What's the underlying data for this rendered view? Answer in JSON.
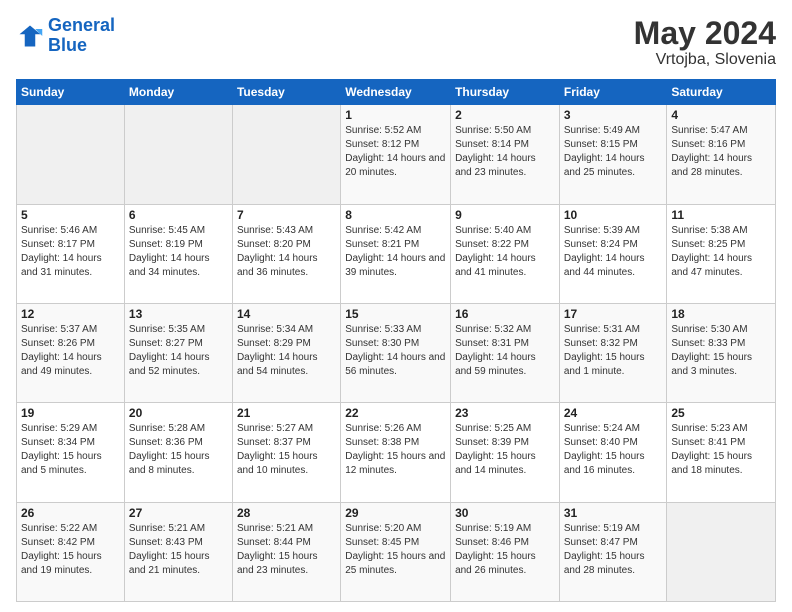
{
  "header": {
    "logo_line1": "General",
    "logo_line2": "Blue",
    "title": "May 2024",
    "subtitle": "Vrtojba, Slovenia"
  },
  "days_of_week": [
    "Sunday",
    "Monday",
    "Tuesday",
    "Wednesday",
    "Thursday",
    "Friday",
    "Saturday"
  ],
  "weeks": [
    [
      {
        "day": "",
        "sunrise": "",
        "sunset": "",
        "daylight": ""
      },
      {
        "day": "",
        "sunrise": "",
        "sunset": "",
        "daylight": ""
      },
      {
        "day": "",
        "sunrise": "",
        "sunset": "",
        "daylight": ""
      },
      {
        "day": "1",
        "sunrise": "Sunrise: 5:52 AM",
        "sunset": "Sunset: 8:12 PM",
        "daylight": "Daylight: 14 hours and 20 minutes."
      },
      {
        "day": "2",
        "sunrise": "Sunrise: 5:50 AM",
        "sunset": "Sunset: 8:14 PM",
        "daylight": "Daylight: 14 hours and 23 minutes."
      },
      {
        "day": "3",
        "sunrise": "Sunrise: 5:49 AM",
        "sunset": "Sunset: 8:15 PM",
        "daylight": "Daylight: 14 hours and 25 minutes."
      },
      {
        "day": "4",
        "sunrise": "Sunrise: 5:47 AM",
        "sunset": "Sunset: 8:16 PM",
        "daylight": "Daylight: 14 hours and 28 minutes."
      }
    ],
    [
      {
        "day": "5",
        "sunrise": "Sunrise: 5:46 AM",
        "sunset": "Sunset: 8:17 PM",
        "daylight": "Daylight: 14 hours and 31 minutes."
      },
      {
        "day": "6",
        "sunrise": "Sunrise: 5:45 AM",
        "sunset": "Sunset: 8:19 PM",
        "daylight": "Daylight: 14 hours and 34 minutes."
      },
      {
        "day": "7",
        "sunrise": "Sunrise: 5:43 AM",
        "sunset": "Sunset: 8:20 PM",
        "daylight": "Daylight: 14 hours and 36 minutes."
      },
      {
        "day": "8",
        "sunrise": "Sunrise: 5:42 AM",
        "sunset": "Sunset: 8:21 PM",
        "daylight": "Daylight: 14 hours and 39 minutes."
      },
      {
        "day": "9",
        "sunrise": "Sunrise: 5:40 AM",
        "sunset": "Sunset: 8:22 PM",
        "daylight": "Daylight: 14 hours and 41 minutes."
      },
      {
        "day": "10",
        "sunrise": "Sunrise: 5:39 AM",
        "sunset": "Sunset: 8:24 PM",
        "daylight": "Daylight: 14 hours and 44 minutes."
      },
      {
        "day": "11",
        "sunrise": "Sunrise: 5:38 AM",
        "sunset": "Sunset: 8:25 PM",
        "daylight": "Daylight: 14 hours and 47 minutes."
      }
    ],
    [
      {
        "day": "12",
        "sunrise": "Sunrise: 5:37 AM",
        "sunset": "Sunset: 8:26 PM",
        "daylight": "Daylight: 14 hours and 49 minutes."
      },
      {
        "day": "13",
        "sunrise": "Sunrise: 5:35 AM",
        "sunset": "Sunset: 8:27 PM",
        "daylight": "Daylight: 14 hours and 52 minutes."
      },
      {
        "day": "14",
        "sunrise": "Sunrise: 5:34 AM",
        "sunset": "Sunset: 8:29 PM",
        "daylight": "Daylight: 14 hours and 54 minutes."
      },
      {
        "day": "15",
        "sunrise": "Sunrise: 5:33 AM",
        "sunset": "Sunset: 8:30 PM",
        "daylight": "Daylight: 14 hours and 56 minutes."
      },
      {
        "day": "16",
        "sunrise": "Sunrise: 5:32 AM",
        "sunset": "Sunset: 8:31 PM",
        "daylight": "Daylight: 14 hours and 59 minutes."
      },
      {
        "day": "17",
        "sunrise": "Sunrise: 5:31 AM",
        "sunset": "Sunset: 8:32 PM",
        "daylight": "Daylight: 15 hours and 1 minute."
      },
      {
        "day": "18",
        "sunrise": "Sunrise: 5:30 AM",
        "sunset": "Sunset: 8:33 PM",
        "daylight": "Daylight: 15 hours and 3 minutes."
      }
    ],
    [
      {
        "day": "19",
        "sunrise": "Sunrise: 5:29 AM",
        "sunset": "Sunset: 8:34 PM",
        "daylight": "Daylight: 15 hours and 5 minutes."
      },
      {
        "day": "20",
        "sunrise": "Sunrise: 5:28 AM",
        "sunset": "Sunset: 8:36 PM",
        "daylight": "Daylight: 15 hours and 8 minutes."
      },
      {
        "day": "21",
        "sunrise": "Sunrise: 5:27 AM",
        "sunset": "Sunset: 8:37 PM",
        "daylight": "Daylight: 15 hours and 10 minutes."
      },
      {
        "day": "22",
        "sunrise": "Sunrise: 5:26 AM",
        "sunset": "Sunset: 8:38 PM",
        "daylight": "Daylight: 15 hours and 12 minutes."
      },
      {
        "day": "23",
        "sunrise": "Sunrise: 5:25 AM",
        "sunset": "Sunset: 8:39 PM",
        "daylight": "Daylight: 15 hours and 14 minutes."
      },
      {
        "day": "24",
        "sunrise": "Sunrise: 5:24 AM",
        "sunset": "Sunset: 8:40 PM",
        "daylight": "Daylight: 15 hours and 16 minutes."
      },
      {
        "day": "25",
        "sunrise": "Sunrise: 5:23 AM",
        "sunset": "Sunset: 8:41 PM",
        "daylight": "Daylight: 15 hours and 18 minutes."
      }
    ],
    [
      {
        "day": "26",
        "sunrise": "Sunrise: 5:22 AM",
        "sunset": "Sunset: 8:42 PM",
        "daylight": "Daylight: 15 hours and 19 minutes."
      },
      {
        "day": "27",
        "sunrise": "Sunrise: 5:21 AM",
        "sunset": "Sunset: 8:43 PM",
        "daylight": "Daylight: 15 hours and 21 minutes."
      },
      {
        "day": "28",
        "sunrise": "Sunrise: 5:21 AM",
        "sunset": "Sunset: 8:44 PM",
        "daylight": "Daylight: 15 hours and 23 minutes."
      },
      {
        "day": "29",
        "sunrise": "Sunrise: 5:20 AM",
        "sunset": "Sunset: 8:45 PM",
        "daylight": "Daylight: 15 hours and 25 minutes."
      },
      {
        "day": "30",
        "sunrise": "Sunrise: 5:19 AM",
        "sunset": "Sunset: 8:46 PM",
        "daylight": "Daylight: 15 hours and 26 minutes."
      },
      {
        "day": "31",
        "sunrise": "Sunrise: 5:19 AM",
        "sunset": "Sunset: 8:47 PM",
        "daylight": "Daylight: 15 hours and 28 minutes."
      },
      {
        "day": "",
        "sunrise": "",
        "sunset": "",
        "daylight": ""
      }
    ]
  ]
}
